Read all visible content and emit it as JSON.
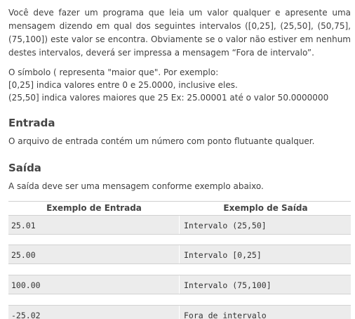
{
  "description": {
    "paragraph": "Você deve fazer um programa que leia um valor qualquer e apresente uma mensagem dizendo em qual dos seguintes intervalos ([0,25], (25,50], (50,75], (75,100]) este valor se encontra. Obviamente se o valor não estiver em nenhum destes intervalos, deverá ser impressa a mensagem “Fora de intervalo”.",
    "note_lines": [
      "O símbolo ( representa \"maior que\". Por exemplo:",
      "[0,25]  indica valores entre 0 e 25.0000, inclusive eles.",
      "(25,50] indica valores maiores que 25 Ex: 25.00001 até o valor 50.0000000"
    ]
  },
  "input_section": {
    "heading": "Entrada",
    "text": "O arquivo de entrada contém um número com ponto flutuante qualquer."
  },
  "output_section": {
    "heading": "Saída",
    "text": "A saída deve ser uma mensagem conforme exemplo abaixo."
  },
  "samples": {
    "header_input": "Exemplo de Entrada",
    "header_output": "Exemplo de Saída",
    "rows": [
      {
        "input": "25.01",
        "output": "Intervalo (25,50]"
      },
      {
        "input": "25.00",
        "output": "Intervalo [0,25]"
      },
      {
        "input": "100.00",
        "output": "Intervalo (75,100]"
      },
      {
        "input": "-25.02",
        "output": "Fora de intervalo"
      }
    ]
  }
}
